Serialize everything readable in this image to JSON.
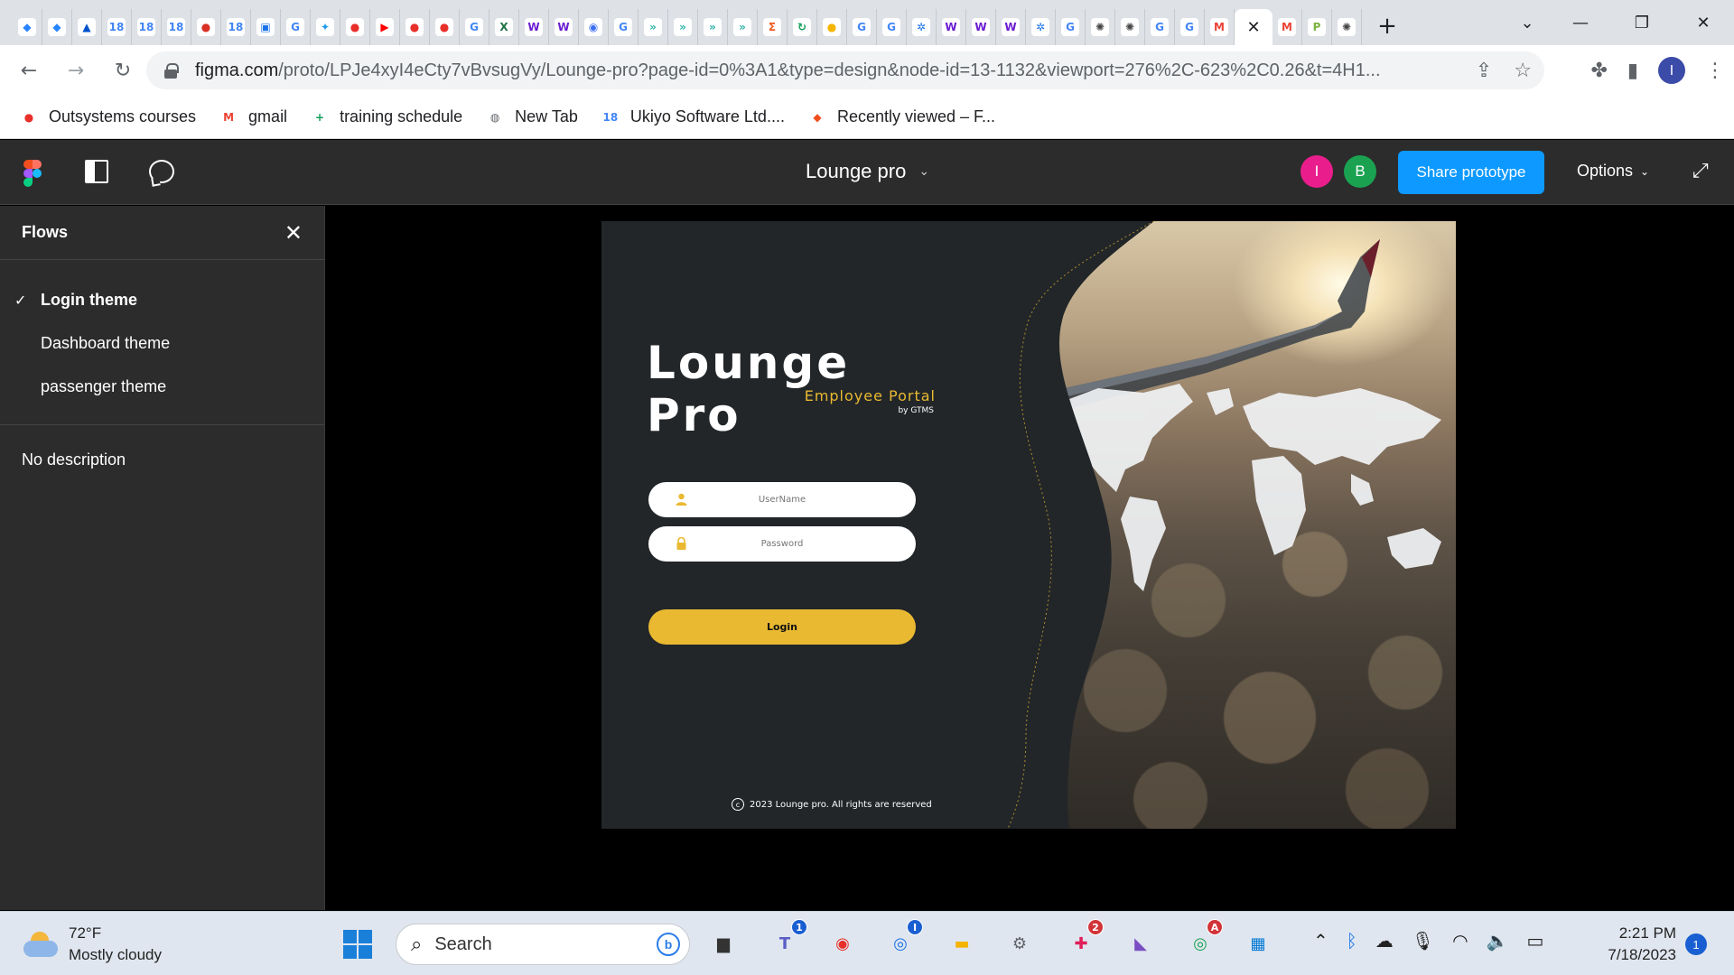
{
  "browser": {
    "tabs": [
      {
        "icon": "jira-diamond-icon",
        "glyph": "◆",
        "color": "#2684ff"
      },
      {
        "icon": "jira-diamond-icon",
        "glyph": "◆",
        "color": "#2684ff"
      },
      {
        "icon": "confluence-icon",
        "glyph": "▲",
        "color": "#0052cc"
      },
      {
        "icon": "calendar-icon",
        "glyph": "18",
        "color": "#4285f4"
      },
      {
        "icon": "calendar-icon",
        "glyph": "18",
        "color": "#4285f4"
      },
      {
        "icon": "calendar-icon",
        "glyph": "18",
        "color": "#4285f4"
      },
      {
        "icon": "record-icon",
        "glyph": "●",
        "color": "#d93025"
      },
      {
        "icon": "calendar-icon",
        "glyph": "18",
        "color": "#4285f4"
      },
      {
        "icon": "meet-icon",
        "glyph": "▣",
        "color": "#1a73e8"
      },
      {
        "icon": "google-icon",
        "glyph": "G",
        "color": "#4285f4"
      },
      {
        "icon": "twitter-icon",
        "glyph": "✦",
        "color": "#1d9bf0"
      },
      {
        "icon": "outsystems-icon",
        "glyph": "●",
        "color": "#e8302a"
      },
      {
        "icon": "youtube-icon",
        "glyph": "▶",
        "color": "#ff0000"
      },
      {
        "icon": "outsystems-icon",
        "glyph": "●",
        "color": "#e8302a"
      },
      {
        "icon": "outsystems-icon",
        "glyph": "●",
        "color": "#e8302a"
      },
      {
        "icon": "google-icon",
        "glyph": "G",
        "color": "#4285f4"
      },
      {
        "icon": "excel-icon",
        "glyph": "X",
        "color": "#1d6f42"
      },
      {
        "icon": "w-icon",
        "glyph": "W",
        "color": "#6a1bd1"
      },
      {
        "icon": "w-icon",
        "glyph": "W",
        "color": "#6a1bd1"
      },
      {
        "icon": "shield-icon",
        "glyph": "◉",
        "color": "#3a6df0"
      },
      {
        "icon": "google-icon",
        "glyph": "G",
        "color": "#4285f4"
      },
      {
        "icon": "arrows-icon",
        "glyph": "»",
        "color": "#2bb3a6"
      },
      {
        "icon": "arrows-icon",
        "glyph": "»",
        "color": "#2bb3a6"
      },
      {
        "icon": "arrows-icon",
        "glyph": "»",
        "color": "#2bb3a6"
      },
      {
        "icon": "arrows-icon",
        "glyph": "»",
        "color": "#2bb3a6"
      },
      {
        "icon": "sigma-icon",
        "glyph": "Σ",
        "color": "#f05a22"
      },
      {
        "icon": "refresh-icon",
        "glyph": "↻",
        "color": "#0f9d58"
      },
      {
        "icon": "coin-icon",
        "glyph": "●",
        "color": "#f4b400"
      },
      {
        "icon": "google-icon",
        "glyph": "G",
        "color": "#4285f4"
      },
      {
        "icon": "google-icon",
        "glyph": "G",
        "color": "#4285f4"
      },
      {
        "icon": "gear-blue-icon",
        "glyph": "✲",
        "color": "#1a73e8"
      },
      {
        "icon": "w-icon",
        "glyph": "W",
        "color": "#6a1bd1"
      },
      {
        "icon": "w-icon",
        "glyph": "W",
        "color": "#6a1bd1"
      },
      {
        "icon": "w-icon",
        "glyph": "W",
        "color": "#6a1bd1"
      },
      {
        "icon": "gear-blue-icon",
        "glyph": "✲",
        "color": "#1a73e8"
      },
      {
        "icon": "google-icon",
        "glyph": "G",
        "color": "#4285f4"
      },
      {
        "icon": "chatgpt-icon",
        "glyph": "✺",
        "color": "#444444"
      },
      {
        "icon": "chatgpt-icon",
        "glyph": "✺",
        "color": "#444444"
      },
      {
        "icon": "google-icon",
        "glyph": "G",
        "color": "#4285f4"
      },
      {
        "icon": "google-icon",
        "glyph": "G",
        "color": "#4285f4"
      },
      {
        "icon": "gmail-icon",
        "glyph": "M",
        "color": "#ea4335"
      }
    ],
    "tabs_after": [
      {
        "icon": "gmail-icon",
        "glyph": "M",
        "color": "#ea4335"
      },
      {
        "icon": "p-icon",
        "glyph": "P",
        "color": "#7cb342"
      },
      {
        "icon": "chatgpt-icon",
        "glyph": "✺",
        "color": "#444444"
      }
    ],
    "active_tab_close": "✕",
    "new_tab": "+",
    "url_host": "figma.com",
    "url_path": "/proto/LPJe4xyI4eCty7vBvsugVy/Lounge-pro?page-id=0%3A1&type=design&node-id=13-1132&viewport=276%2C-623%2C0.26&t=4H1...",
    "profile_initial": "I",
    "bookmarks": [
      {
        "label": "Outsystems courses",
        "icon": "outsystems-icon",
        "glyph": "●",
        "color": "#e8302a"
      },
      {
        "label": "gmail",
        "icon": "gmail-icon",
        "glyph": "M",
        "color": "#ea4335"
      },
      {
        "label": "training schedule",
        "icon": "sheets-icon",
        "glyph": "+",
        "color": "#0f9d58"
      },
      {
        "label": "New Tab",
        "icon": "globe-icon",
        "glyph": "◍",
        "color": "#5f6368"
      },
      {
        "label": "Ukiyo Software Ltd....",
        "icon": "calendar-icon",
        "glyph": "18",
        "color": "#4285f4"
      },
      {
        "label": "Recently viewed – F...",
        "icon": "figma-icon",
        "glyph": "◆",
        "color": "#f24e1e"
      }
    ]
  },
  "figma": {
    "file_title": "Lounge pro",
    "collaborators": [
      {
        "initial": "I",
        "color": "#e91e8c"
      },
      {
        "initial": "B",
        "color": "#1aa251"
      }
    ],
    "share_label": "Share prototype",
    "options_label": "Options",
    "sidebar": {
      "title": "Flows",
      "flows": [
        {
          "label": "Login theme",
          "active": true
        },
        {
          "label": "Dashboard theme",
          "active": false
        },
        {
          "label": "passenger theme",
          "active": false
        }
      ],
      "description": "No description"
    }
  },
  "design": {
    "brand_title": "Lounge Pro",
    "brand_subtitle": "Employee Portal",
    "brand_by": "by GTMS",
    "username_placeholder": "UserName",
    "password_placeholder": "Password",
    "login_label": "Login",
    "footer": "2023 Lounge pro. All rights are reserved",
    "accent_color": "#e9b931"
  },
  "taskbar": {
    "temperature": "72°F",
    "condition": "Mostly cloudy",
    "search_label": "Search",
    "time": "2:21 PM",
    "date": "7/18/2023",
    "notification_count": "1",
    "apps": [
      {
        "name": "file-icon",
        "glyph": "▆",
        "color": "#333333",
        "badge": ""
      },
      {
        "name": "teams-icon",
        "glyph": "T",
        "color": "#5b5fc7",
        "badge": "1"
      },
      {
        "name": "screen-record-icon",
        "glyph": "◉",
        "color": "#e8302a",
        "badge": ""
      },
      {
        "name": "chrome-icon",
        "glyph": "◎",
        "color": "#1a73e8",
        "badge": "I"
      },
      {
        "name": "folder-icon",
        "glyph": "▬",
        "color": "#f4b400",
        "badge": ""
      },
      {
        "name": "settings-icon",
        "glyph": "⚙",
        "color": "#5f6368",
        "badge": ""
      },
      {
        "name": "slack-icon",
        "glyph": "✚",
        "color": "#e01e5a",
        "badge": "2"
      },
      {
        "name": "visual-studio-icon",
        "glyph": "◣",
        "color": "#7b4fc4",
        "badge": ""
      },
      {
        "name": "chrome-profile-icon",
        "glyph": "◎",
        "color": "#1aa251",
        "badge": "A"
      },
      {
        "name": "store-icon",
        "glyph": "▦",
        "color": "#0078d4",
        "badge": ""
      }
    ]
  }
}
